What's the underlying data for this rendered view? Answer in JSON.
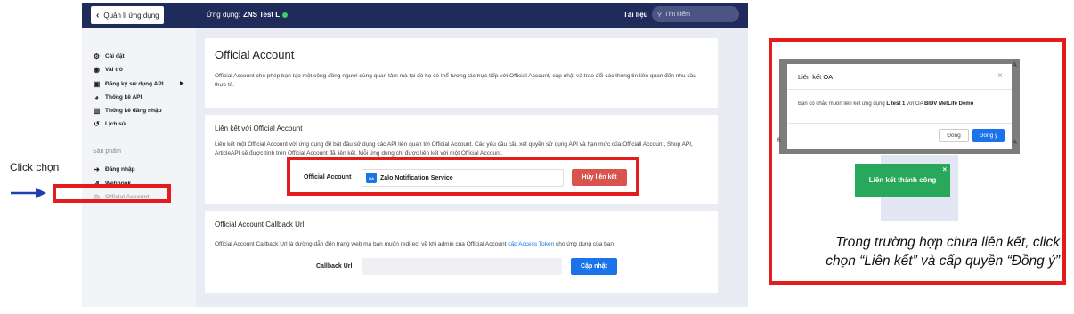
{
  "annotation": {
    "click_label": "Click chọn",
    "instruction_line1": "Trong trường hợp chưa liên kết, click",
    "instruction_line2": "chọn “Liên kết” và cấp quyền “Đồng ý”"
  },
  "colors": {
    "highlight": "#e31d1d",
    "topbar": "#1f2b5b",
    "primary": "#1a73e8",
    "danger": "#d9534f",
    "success": "#28a85a"
  },
  "topbar": {
    "back_label": "Quản lí ứng dụng",
    "app_prefix": "Ứng dụng:",
    "app_name": "ZNS Test L",
    "docs_label": "Tài liệu",
    "search_placeholder": "Tìm kiếm"
  },
  "sidebar": {
    "items": [
      {
        "label": "Cài đặt",
        "icon": "gear-icon"
      },
      {
        "label": "Vai trò",
        "icon": "user-icon"
      },
      {
        "label": "Đăng ký sử dụng API",
        "icon": "api-icon"
      },
      {
        "label": "Thống kê API",
        "icon": "gauge-icon"
      },
      {
        "label": "Thống kê đăng nhập",
        "icon": "bar-chart-icon"
      },
      {
        "label": "Lịch sử",
        "icon": "history-icon"
      }
    ],
    "section_label": "Sản phẩm",
    "products": [
      {
        "label": "Đăng nhập",
        "icon": "login-icon"
      },
      {
        "label": "Webhook",
        "icon": "external-link-icon"
      },
      {
        "label": "Official Account",
        "icon": "oa-icon"
      }
    ]
  },
  "main": {
    "title": "Official Account",
    "intro": "Official Account cho phép bạn tạo một cộng đồng người dùng quan tâm mà tại đó họ có thể tương tác trực tiếp với Official Account, cập nhật và trao đổi các thông tin liên quan đến nhu cầu thực tế.",
    "link_section": {
      "title": "Liên kết với Official Account",
      "text": "Liên kết một Official Account với ứng dụng để bắt đầu sử dụng các API liên quan tới Official Account. Các yêu cầu cấu xét quyền sử dụng API và hạn mức của Officiall Account, Shop API, ArticleAPI sẽ được tính trên Official Account đã liên kết. Mỗi ứng dụng chỉ được liên kết với một Official Account.",
      "field_label": "Official Account",
      "oa_value": "Zalo Notification Service",
      "unlink_label": "Hủy liên kết"
    },
    "callback_section": {
      "title": "Official Account Callback Url",
      "text_before": "Official Account Callback Url là đường dẫn đến trang web mà bạn muốn redirect về khi admin của Official Account",
      "text_link": "cấp Access Token",
      "text_after": "cho ứng dụng của bạn.",
      "field_label": "Callback Url",
      "value": "",
      "update_label": "Cập nhật"
    }
  },
  "modal": {
    "title": "Liên kết OA",
    "body_prefix": "Bạn có chắc muốn liên kết ứng dụng",
    "app_bold": "L test 1",
    "body_mid": "với OA",
    "oa_bold": "BIDV MetLife Demo",
    "cancel_label": "Đóng",
    "ok_label": "Đồng ý"
  },
  "toast": {
    "message": "Liên kết thành công",
    "close": "×"
  },
  "bg_fragments": {
    "a": "A",
    "fi": "fi",
    "a2": "A"
  }
}
